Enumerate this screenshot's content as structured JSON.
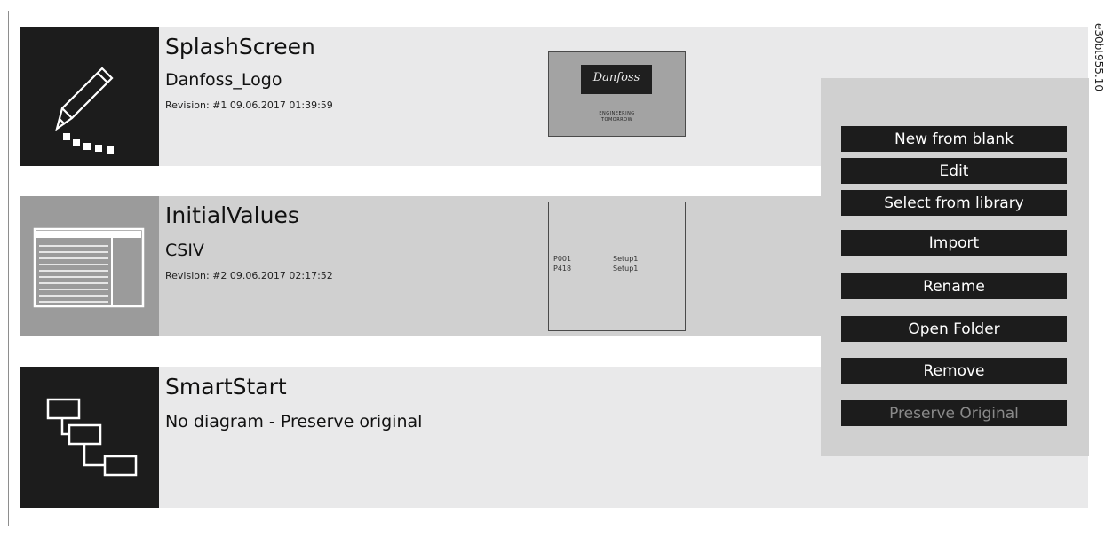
{
  "figure_code": "e30bt955.10",
  "rows": [
    {
      "title": "SplashScreen",
      "subtitle": "Danfoss_Logo",
      "revision": "Revision: #1 09.06.2017 01:39:59",
      "icon": "pencil-icon",
      "thumbnail": {
        "logo_text": "Danfoss",
        "tagline_1": "ENGINEERING",
        "tagline_2": "TOMORROW"
      }
    },
    {
      "title": "InitialValues",
      "subtitle": "CSIV",
      "revision": "Revision: #2 09.06.2017 02:17:52",
      "icon": "table-icon",
      "thumbnail": {
        "lines": [
          {
            "param": "P001",
            "value": "Setup1"
          },
          {
            "param": "P418",
            "value": "Setup1"
          }
        ]
      }
    },
    {
      "title": "SmartStart",
      "subtitle": "No diagram - Preserve original",
      "icon": "flow-diagram-icon"
    }
  ],
  "menu": {
    "items": [
      {
        "label": "New from blank",
        "enabled": true
      },
      {
        "label": "Edit",
        "enabled": true
      },
      {
        "label": "Select from library",
        "enabled": true
      },
      {
        "label": "Import",
        "enabled": true
      },
      {
        "label": "Rename",
        "enabled": true
      },
      {
        "label": "Open Folder",
        "enabled": true
      },
      {
        "label": "Remove",
        "enabled": true
      },
      {
        "label": "Preserve Original",
        "enabled": false
      }
    ]
  },
  "colors": {
    "row_light": "#e9e9ea",
    "row_selected": "#d0d0d0",
    "icon_dark": "#1c1c1c",
    "icon_selected": "#9b9b9b",
    "button_bg": "#1c1c1c",
    "button_text": "#ffffff",
    "button_disabled_text": "#8a8a8a"
  }
}
